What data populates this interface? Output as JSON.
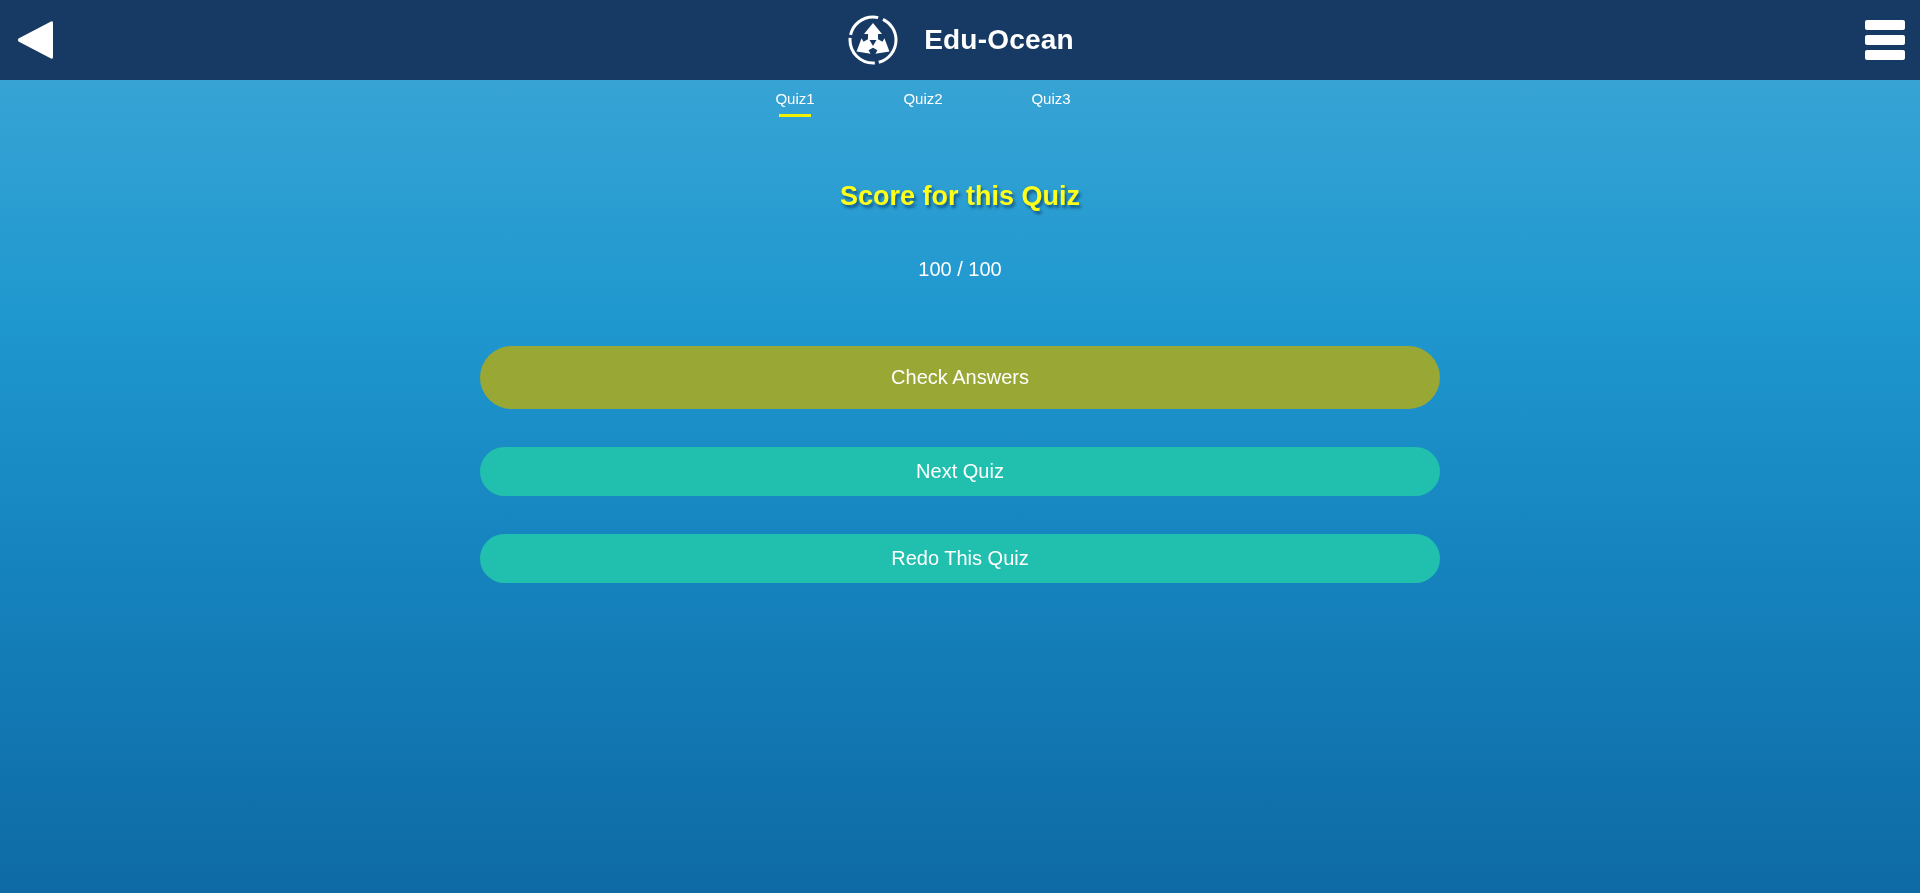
{
  "header": {
    "title": "Edu-Ocean"
  },
  "tabs": [
    {
      "label": "Quiz1",
      "selected": true
    },
    {
      "label": "Quiz2",
      "selected": false
    },
    {
      "label": "Quiz3",
      "selected": false
    }
  ],
  "score": {
    "heading": "Score for this Quiz",
    "value": "100 / 100"
  },
  "actions": [
    {
      "label": "Check Answers",
      "kind": "primary"
    },
    {
      "label": "Next Quiz",
      "kind": "secondary"
    },
    {
      "label": "Redo This Quiz",
      "kind": "secondary"
    }
  ]
}
